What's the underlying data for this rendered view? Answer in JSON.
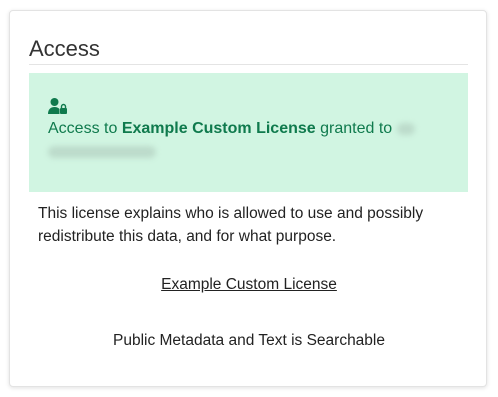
{
  "section": {
    "title": "Access"
  },
  "alert": {
    "icon": "user-lock-icon",
    "prefix": "Access to ",
    "license_name": "Example Custom License",
    "middle": " granted to ",
    "color_bg": "#d1f5e2",
    "color_text": "#0f7a4d"
  },
  "description": "This license explains who is allowed to use and possibly redistribute this data, and for what purpose.",
  "license_link": "Example Custom License",
  "searchable_note": "Public Metadata and Text is Searchable"
}
